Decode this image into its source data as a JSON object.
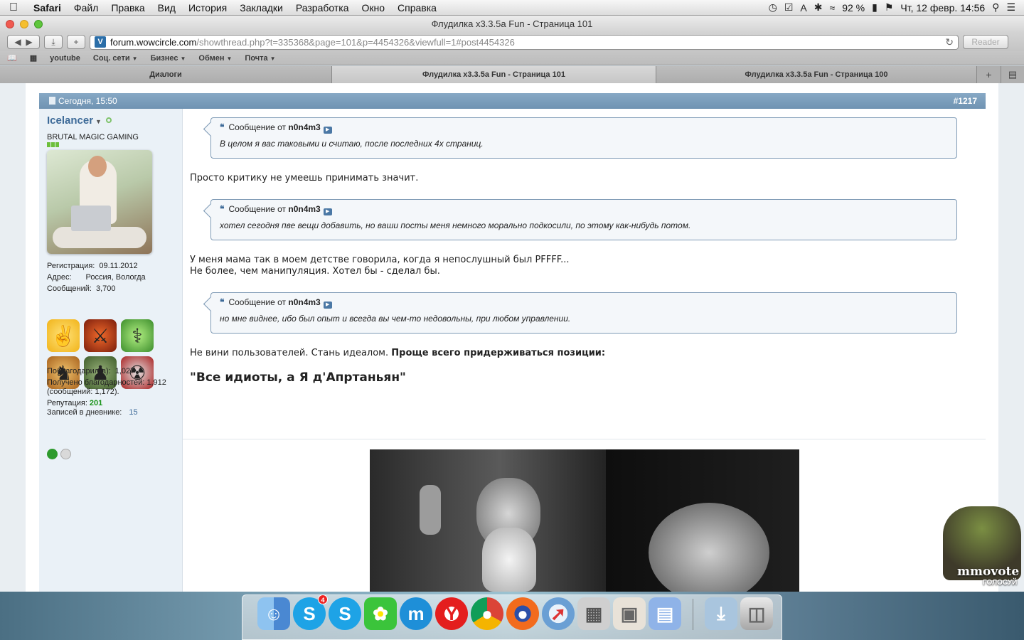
{
  "menubar": {
    "app": "Safari",
    "items": [
      "Файл",
      "Правка",
      "Вид",
      "История",
      "Закладки",
      "Разработка",
      "Окно",
      "Справка"
    ],
    "battery": "92 %",
    "datetime": "Чт, 12 февр.  14:56"
  },
  "window": {
    "title": "Флудилка x3.3.5a Fun - Страница 101"
  },
  "toolbar": {
    "url_host": "forum.wowcircle.com",
    "url_path": "/showthread.php?t=335368&page=101&p=4454326&viewfull=1#post4454326",
    "reader": "Reader"
  },
  "bookmarks": [
    "youtube",
    "Соц. сети",
    "Бизнес",
    "Обмен",
    "Почта"
  ],
  "tabs": [
    {
      "label": "Диалоги"
    },
    {
      "label": "Флудилка x3.3.5a Fun - Страница 101"
    },
    {
      "label": "Флудилка x3.3.5a Fun - Страница 100"
    }
  ],
  "post": {
    "date": "Сегодня, 15:50",
    "number": "#1217",
    "user": {
      "name": "Icelancer",
      "title": "BRUTAL MAGIC GAMING",
      "reg_label": "Регистрация:",
      "reg_value": "09.11.2012",
      "addr_label": "Адрес:",
      "addr_value": "Россия, Вологда",
      "posts_label": "Сообщений:",
      "posts_value": "3,700",
      "thanked_label": "Поблагодарил(а):",
      "thanked_value": "1,027",
      "received_label": "Получено благодарностей:",
      "received_value": "1,912",
      "received_sub": "(сообщений: 1,172).",
      "rep_label": "Репутация:",
      "rep_value": "201",
      "diary_label": "Записей в дневнике:",
      "diary_value": "15"
    },
    "quotes": [
      {
        "prefix": "Сообщение от",
        "author": "n0n4m3",
        "text": "В целом я вас таковыми и считаю, после последних 4х страниц."
      },
      {
        "prefix": "Сообщение от",
        "author": "n0n4m3",
        "text": "хотел сегодня пве вещи добавить, но ваши посты меня немного морально подкосили, по этому как-нибудь потом."
      },
      {
        "prefix": "Сообщение от",
        "author": "n0n4m3",
        "text": "но мне виднее, ибо был опыт и всегда вы чем-то недовольны, при любом управлении."
      }
    ],
    "text1": "Просто критику не умеешь принимать значит.",
    "text2a": "У меня мама так в моем детстве говорила, когда я непослушный был PFFFF...",
    "text2b": "Не более, чем манипуляция. Хотел бы - сделал бы.",
    "text3a": "Не вини пользователей. Стань идеалом. ",
    "text3b": "Проще всего придерживаться позиции:",
    "text4": "\"Все идиоты, а Я д'Апртаньян\""
  },
  "mmovote": {
    "label": "mmovote",
    "sub": "ГОЛОСУЙ"
  },
  "dock": {
    "skype_badge": "4",
    "icons": [
      "finder-icon",
      "skype-icon",
      "skype-icon",
      "icq-icon",
      "maxthon-icon",
      "yandex-browser-icon",
      "chrome-icon",
      "firefox-icon",
      "safari-icon",
      "calculator-icon",
      "preview-icon",
      "textedit-icon",
      "downloads-icon",
      "trash-icon"
    ]
  }
}
